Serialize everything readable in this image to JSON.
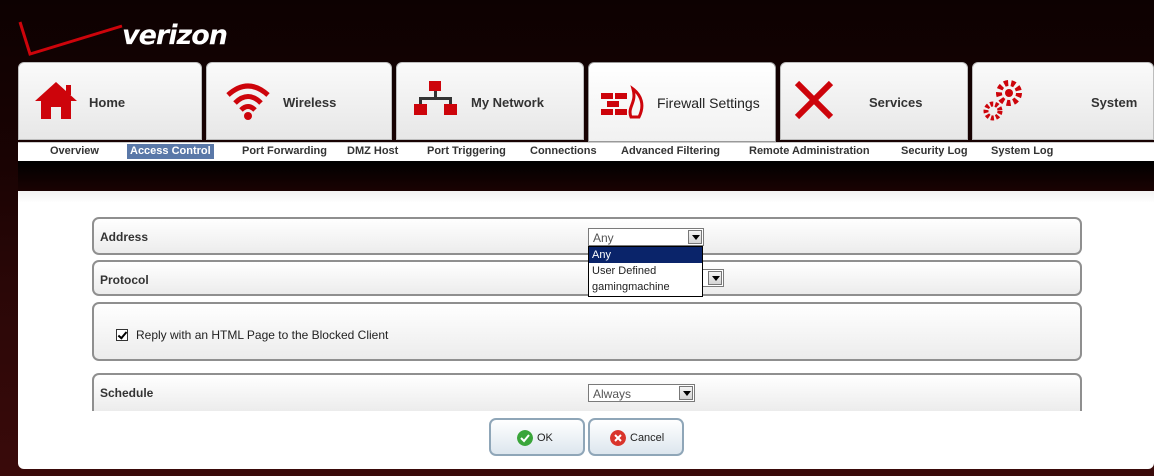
{
  "brand": {
    "name": "verizon"
  },
  "tabs": [
    {
      "label": "Home",
      "icon": "home-icon",
      "active": false
    },
    {
      "label": "Wireless",
      "icon": "wifi-icon",
      "active": false
    },
    {
      "label": "My Network",
      "icon": "network-icon",
      "active": false
    },
    {
      "label": "Firewall Settings",
      "icon": "firewall-icon",
      "active": true
    },
    {
      "label": "Services",
      "icon": "tools-icon",
      "active": false
    },
    {
      "label": "System",
      "icon": "gears-icon",
      "active": false
    }
  ],
  "subnav": [
    {
      "label": "Overview",
      "selected": false
    },
    {
      "label": "Access Control",
      "selected": true
    },
    {
      "label": "Port Forwarding",
      "selected": false
    },
    {
      "label": "DMZ Host",
      "selected": false
    },
    {
      "label": "Port Triggering",
      "selected": false
    },
    {
      "label": "Connections",
      "selected": false
    },
    {
      "label": "Advanced Filtering",
      "selected": false
    },
    {
      "label": "Remote Administration",
      "selected": false
    },
    {
      "label": "Security Log",
      "selected": false
    },
    {
      "label": "System Log",
      "selected": false
    }
  ],
  "form": {
    "address": {
      "label": "Address",
      "value": "Any",
      "options": [
        "Any",
        "User Defined",
        "gamingmachine"
      ],
      "highlighted": "Any"
    },
    "protocol": {
      "label": "Protocol"
    },
    "reply": {
      "label": "Reply with an HTML Page to the Blocked Client",
      "checked": true
    },
    "schedule": {
      "label": "Schedule",
      "value": "Always"
    }
  },
  "buttons": {
    "ok": "OK",
    "cancel": "Cancel"
  },
  "colors": {
    "brand_red": "#cd040b",
    "selected_tab_bg": "#5a78a8",
    "dropdown_highlight": "#0a246a"
  }
}
